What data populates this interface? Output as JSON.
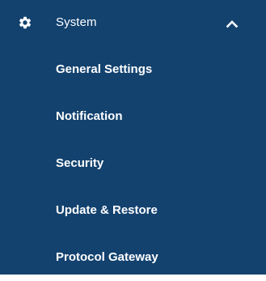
{
  "menu": {
    "header": {
      "label": "System",
      "icon": "gear-icon",
      "expand_icon": "chevron-up-icon"
    },
    "items": [
      {
        "label": "General Settings"
      },
      {
        "label": "Notification"
      },
      {
        "label": "Security"
      },
      {
        "label": "Update & Restore"
      },
      {
        "label": "Protocol Gateway"
      }
    ]
  },
  "colors": {
    "background": "#13426f",
    "text": "#ffffff"
  }
}
